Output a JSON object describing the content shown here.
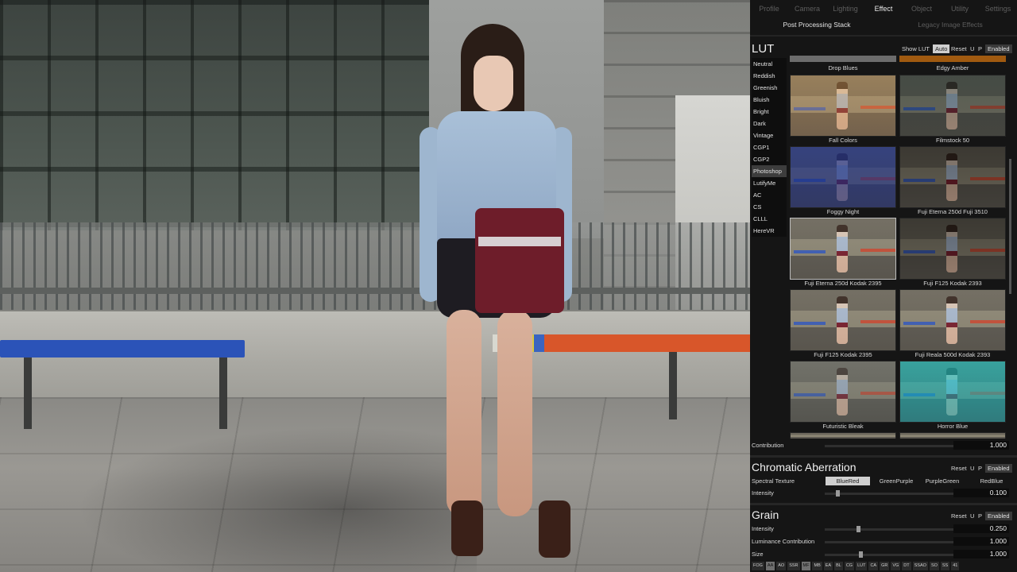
{
  "main_tabs": [
    {
      "label": "Profile",
      "active": false
    },
    {
      "label": "Camera",
      "active": false
    },
    {
      "label": "Lighting",
      "active": false
    },
    {
      "label": "Effect",
      "active": true
    },
    {
      "label": "Object",
      "active": false
    },
    {
      "label": "Utility",
      "active": false
    },
    {
      "label": "Settings",
      "active": false
    }
  ],
  "sub_tabs": [
    {
      "label": "Post Processing Stack",
      "active": true
    },
    {
      "label": "Legacy Image Effects",
      "active": false
    }
  ],
  "lut": {
    "title": "LUT",
    "show_lut": "Show LUT",
    "auto": "Auto",
    "reset": "Reset",
    "u": "U",
    "p": "P",
    "enabled": "Enabled",
    "categories": [
      "Neutral",
      "Reddish",
      "Greenish",
      "Bluish",
      "Bright",
      "Dark",
      "Vintage",
      "CGP1",
      "CGP2",
      "Photoshop",
      "LutifyMe",
      "AC",
      "CS",
      "CLLL",
      "HereVR"
    ],
    "active_category": "Photoshop",
    "top_labels": [
      "Drop Blues",
      "Edgy Amber"
    ],
    "thumbnails": [
      {
        "label": "Fall Colors",
        "tint": "warm"
      },
      {
        "label": "Filmstock 50",
        "tint": "cool-dark"
      },
      {
        "label": "Foggy Night",
        "tint": "blue"
      },
      {
        "label": "Fuji Eterna 250d Fuji 3510",
        "tint": "dark"
      },
      {
        "label": "Fuji Eterna 250d Kodak 2395",
        "tint": "neutral",
        "selected": true
      },
      {
        "label": "Fuji F125 Kodak 2393",
        "tint": "dark"
      },
      {
        "label": "Fuji F125 Kodak 2395",
        "tint": "neutral"
      },
      {
        "label": "Fuji Reala 500d Kodak 2393",
        "tint": "neutral"
      },
      {
        "label": "Futuristic Bleak",
        "tint": "gray"
      },
      {
        "label": "Horror Blue",
        "tint": "cyan"
      }
    ],
    "contribution_label": "Contribution",
    "contribution_value": "1.000",
    "contribution_level": 1.0
  },
  "chromatic": {
    "title": "Chromatic Aberration",
    "reset": "Reset",
    "u": "U",
    "p": "P",
    "enabled": "Enabled",
    "spectral_label": "Spectral Texture",
    "options": [
      "BlueRed",
      "GreenPurple",
      "PurpleGreen",
      "RedBlue"
    ],
    "selected": "BlueRed",
    "intensity_label": "Intensity",
    "intensity_value": "0.100",
    "intensity_level": 0.1
  },
  "grain": {
    "title": "Grain",
    "reset": "Reset",
    "u": "U",
    "p": "P",
    "enabled": "Enabled",
    "intensity_label": "Intensity",
    "intensity_value": "0.250",
    "intensity_level": 0.25,
    "luminance_label": "Luminance Contribution",
    "luminance_value": "1.000",
    "luminance_level": 1.0,
    "size_label": "Size",
    "size_value": "1.000",
    "size_level": 0.27
  },
  "bottom_bar": [
    {
      "label": "FOG",
      "on": false
    },
    {
      "label": "AA",
      "on": true
    },
    {
      "label": "AO",
      "on": false
    },
    {
      "label": "SSR",
      "on": false
    },
    {
      "label": "MF",
      "on": true
    },
    {
      "label": "MB",
      "on": false
    },
    {
      "label": "EA",
      "on": false
    },
    {
      "label": "BL",
      "on": false
    },
    {
      "label": "CG",
      "on": false
    },
    {
      "label": "LUT",
      "on": false
    },
    {
      "label": "CA",
      "on": false
    },
    {
      "label": "GR",
      "on": false
    },
    {
      "label": "VG",
      "on": false
    },
    {
      "label": "DT",
      "on": false
    },
    {
      "label": "SSAO",
      "on": false
    },
    {
      "label": "SO",
      "on": false
    },
    {
      "label": "SS",
      "on": false
    },
    {
      "label": "41",
      "on": false
    }
  ]
}
